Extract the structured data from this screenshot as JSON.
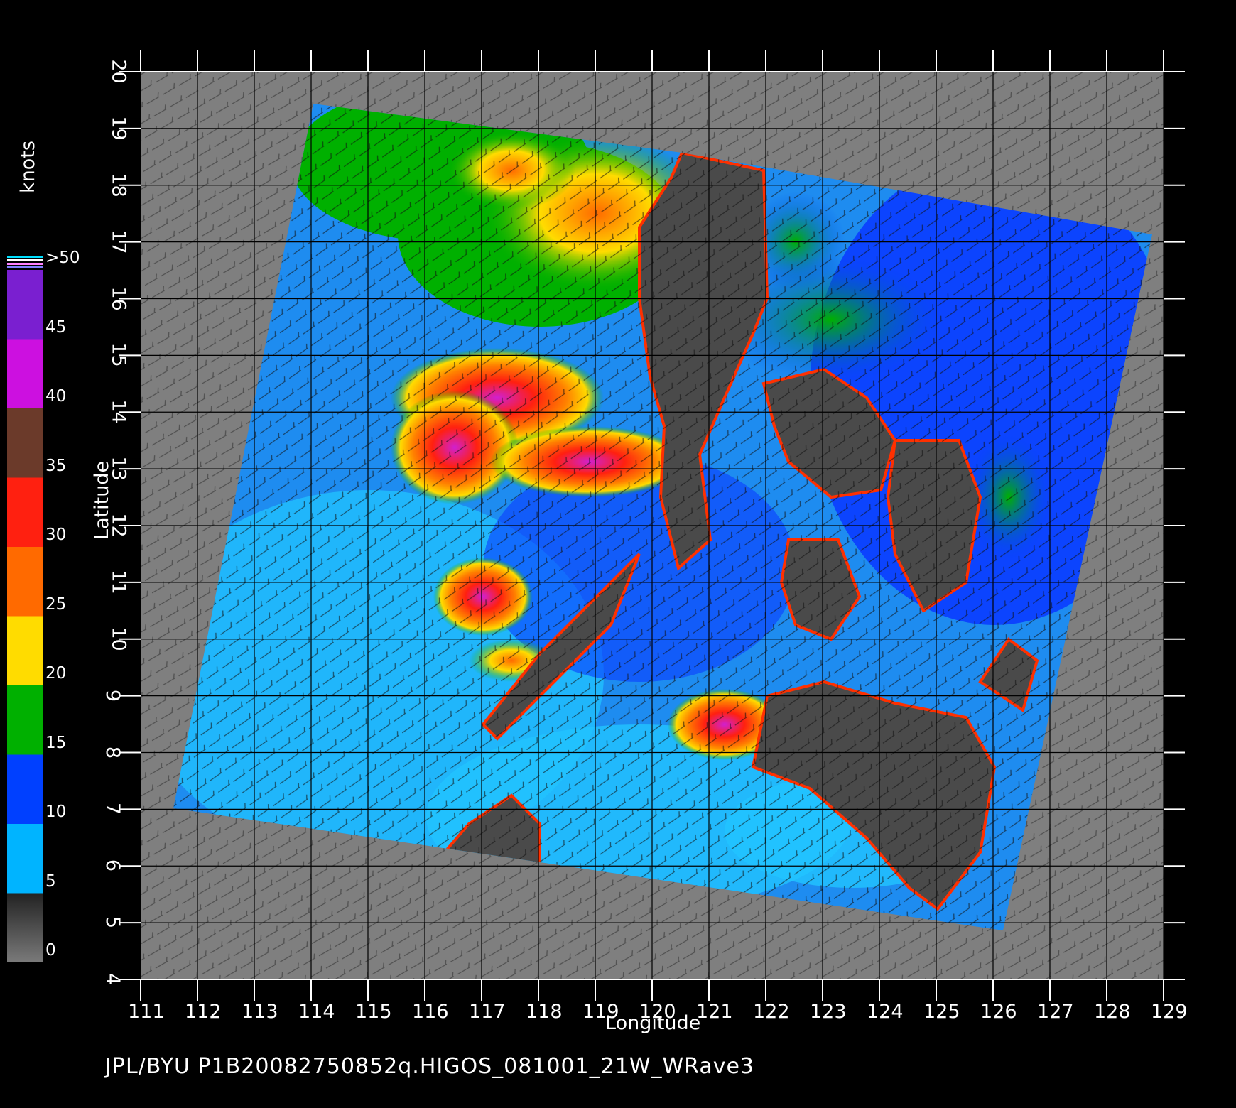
{
  "colorbar": {
    "title": "knots",
    "labels": [
      ">50",
      "45",
      "40",
      "35",
      "30",
      "25",
      "20",
      "15",
      "10",
      "5",
      "0"
    ],
    "bands": [
      {
        "from": 45,
        "to": 50,
        "color": "#7a1fd0"
      },
      {
        "from": 40,
        "to": 45,
        "color": "#cc10e0"
      },
      {
        "from": 35,
        "to": 40,
        "color": "#6b3a2a"
      },
      {
        "from": 30,
        "to": 35,
        "color": "#ff2010"
      },
      {
        "from": 25,
        "to": 30,
        "color": "#ff6a00"
      },
      {
        "from": 20,
        "to": 25,
        "color": "#ffdc00"
      },
      {
        "from": 15,
        "to": 20,
        "color": "#00b000"
      },
      {
        "from": 10,
        "to": 15,
        "color": "#0040ff"
      },
      {
        "from": 5,
        "to": 10,
        "color": "#00b4ff"
      },
      {
        "from": 0,
        "to": 5,
        "color": "#606060"
      }
    ]
  },
  "axes": {
    "xlabel": "Longitude",
    "ylabel": "Latitude",
    "lon_range": [
      111,
      129
    ],
    "lat_range": [
      4,
      20
    ],
    "lon_ticks": [
      "111",
      "112",
      "113",
      "114",
      "115",
      "116",
      "117",
      "118",
      "119",
      "120",
      "121",
      "122",
      "123",
      "124",
      "125",
      "126",
      "127",
      "128",
      "129"
    ],
    "lat_ticks": [
      "4",
      "5",
      "6",
      "7",
      "8",
      "9",
      "10",
      "11",
      "12",
      "13",
      "14",
      "15",
      "16",
      "17",
      "18",
      "19",
      "20"
    ]
  },
  "footer": "JPL/BYU  P1B20082750852q.HIGOS_081001_21W_WRave3",
  "colors": {
    "background": "#000000",
    "no_data": "#7f7f7f",
    "land": "#4a4a4a",
    "grid": "#000000"
  }
}
